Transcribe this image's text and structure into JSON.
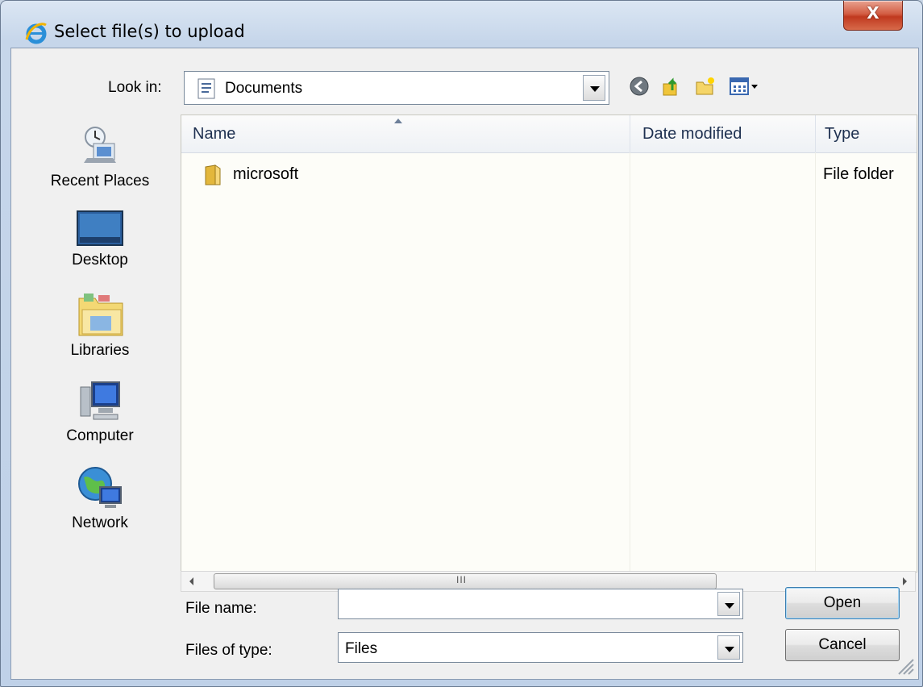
{
  "window": {
    "title": "Select file(s) to upload",
    "close_label": "X"
  },
  "lookin": {
    "label": "Look in:",
    "value": "Documents"
  },
  "toolbar": {
    "icons": [
      "back-icon",
      "up-folder-icon",
      "new-folder-icon",
      "view-menu-icon"
    ]
  },
  "places": [
    {
      "label": "Recent Places",
      "icon": "recent-places-icon"
    },
    {
      "label": "Desktop",
      "icon": "desktop-icon"
    },
    {
      "label": "Libraries",
      "icon": "libraries-icon"
    },
    {
      "label": "Computer",
      "icon": "computer-icon"
    },
    {
      "label": "Network",
      "icon": "network-icon"
    }
  ],
  "list": {
    "columns": [
      "Name",
      "Date modified",
      "Type"
    ],
    "rows": [
      {
        "name": "microsoft",
        "date_modified": "",
        "type": "File folder",
        "icon": "folder-icon"
      }
    ]
  },
  "scrollbar": {
    "grip": "III"
  },
  "form": {
    "file_name_label": "File name:",
    "file_name_value": "",
    "file_type_label": "Files of type:",
    "file_type_value": "Files"
  },
  "buttons": {
    "open": "Open",
    "cancel": "Cancel"
  },
  "colors": {
    "titlebar": "#c6d6ea",
    "close_button": "#c0391f",
    "list_background": "#fdfdf8"
  }
}
